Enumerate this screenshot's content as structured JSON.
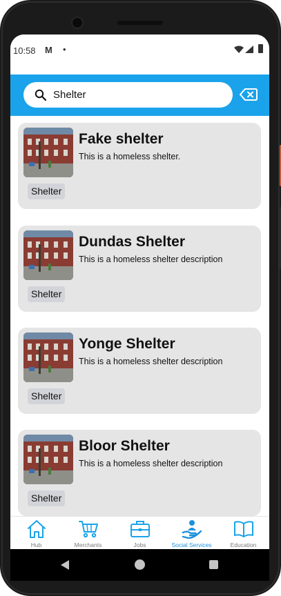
{
  "status": {
    "time": "10:58",
    "mail_glyph": "M",
    "dot": "•"
  },
  "search": {
    "value": "Shelter"
  },
  "results": [
    {
      "title": "Fake shelter",
      "description": "This is a homeless shelter.",
      "tag": "Shelter"
    },
    {
      "title": "Dundas Shelter",
      "description": "This is a homeless shelter description",
      "tag": "Shelter"
    },
    {
      "title": "Yonge Shelter",
      "description": "This is a homeless shelter description",
      "tag": "Shelter"
    },
    {
      "title": "Bloor Shelter",
      "description": "This is a homeless shelter description",
      "tag": "Shelter"
    }
  ],
  "bottom_nav": [
    {
      "label": "Hub",
      "icon": "home-icon"
    },
    {
      "label": "Merchants",
      "icon": "cart-icon"
    },
    {
      "label": "Jobs",
      "icon": "briefcase-icon"
    },
    {
      "label": "Social Services",
      "icon": "social-services-icon",
      "active": true
    },
    {
      "label": "Education",
      "icon": "book-icon"
    }
  ],
  "colors": {
    "accent": "#1aa3ea",
    "card": "#e5e5e5",
    "tag": "#d3d4d9",
    "nav_active": "#1a8fdd"
  }
}
